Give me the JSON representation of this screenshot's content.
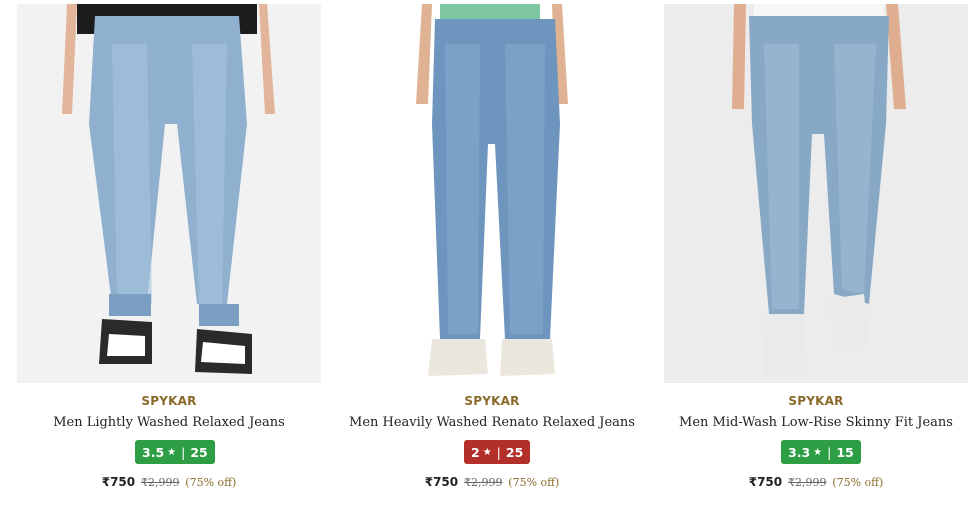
{
  "products": [
    {
      "brand": "SPYKAR",
      "title": "Men Lightly Washed Relaxed Jeans",
      "rating": "3.5",
      "rating_count": "25",
      "rating_color": "#2e9e44",
      "price": "₹750",
      "mrp": "2,999",
      "discount": "(75% off)",
      "image_icon": "jeans-image"
    },
    {
      "brand": "SPYKAR",
      "title": "Men Heavily Washed Renato Relaxed Jeans",
      "rating": "2",
      "rating_count": "25",
      "rating_color": "#b3302a",
      "price": "₹750",
      "mrp": "2,999",
      "discount": "(75% off)",
      "image_icon": "jeans-image"
    },
    {
      "brand": "SPYKAR",
      "title": "Men Mid-Wash Low-Rise Skinny Fit Jeans",
      "rating": "3.3",
      "rating_count": "15",
      "rating_color": "#2e9e44",
      "price": "₹750",
      "mrp": "2,999",
      "discount": "(75% off)",
      "image_icon": "jeans-image"
    }
  ],
  "currency_symbol": "₹",
  "star_glyph": "★",
  "separator": "|"
}
